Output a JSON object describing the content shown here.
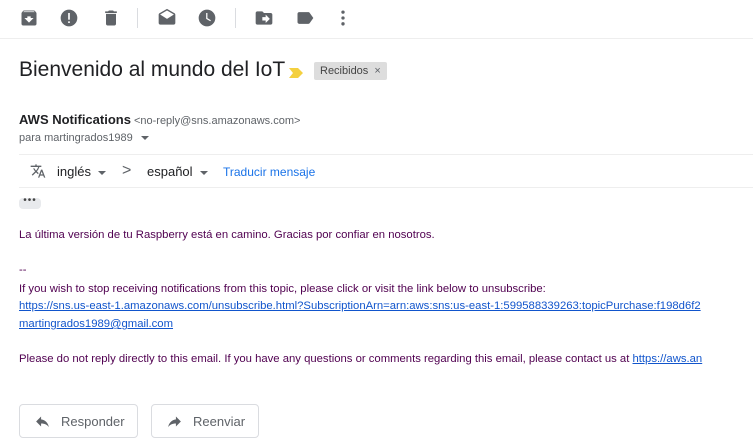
{
  "toolbar": {
    "icons": [
      "archive-icon",
      "report-spam-icon",
      "delete-icon",
      "mark-unread-icon",
      "snooze-icon",
      "move-to-icon",
      "label-icon",
      "more-vert-icon"
    ]
  },
  "email": {
    "subject": "Bienvenido al mundo del IoT",
    "label": "Recibidos",
    "label_remove": "×",
    "sender_name": "AWS Notifications",
    "sender_email": "<no-reply@sns.amazonaws.com>",
    "to": "para martingrados1989"
  },
  "translate": {
    "from_lang": "inglés",
    "arrow": ">",
    "to_lang": "español",
    "action": "Traducir mensaje"
  },
  "body": {
    "ellipsis": "•••",
    "line1": "La última versión de tu Raspberry está en camino. Gracias por confiar en nosotros.",
    "separator": "--",
    "line2": "If you wish to stop receiving notifications from this topic, please click or visit the link below to unsubscribe:",
    "unsubscribe_link": "https://sns.us-east-1.amazonaws.com/unsubscribe.html?SubscriptionArn=arn:aws:sns:us-east-1:599588339263:topicPurchase:f198d6f2",
    "email_link": "martingrados1989@gmail.com",
    "line3": "Please do not reply directly to this email. If you have any questions or comments regarding this email, please contact us at",
    "contact_link": "https://aws.an"
  },
  "actions": {
    "reply": "Responder",
    "forward": "Reenviar"
  },
  "colors": {
    "body_text": "#500050",
    "link": "#1155cc",
    "translate_link": "#1a73e8",
    "importance_marker": "#f4d03f"
  }
}
